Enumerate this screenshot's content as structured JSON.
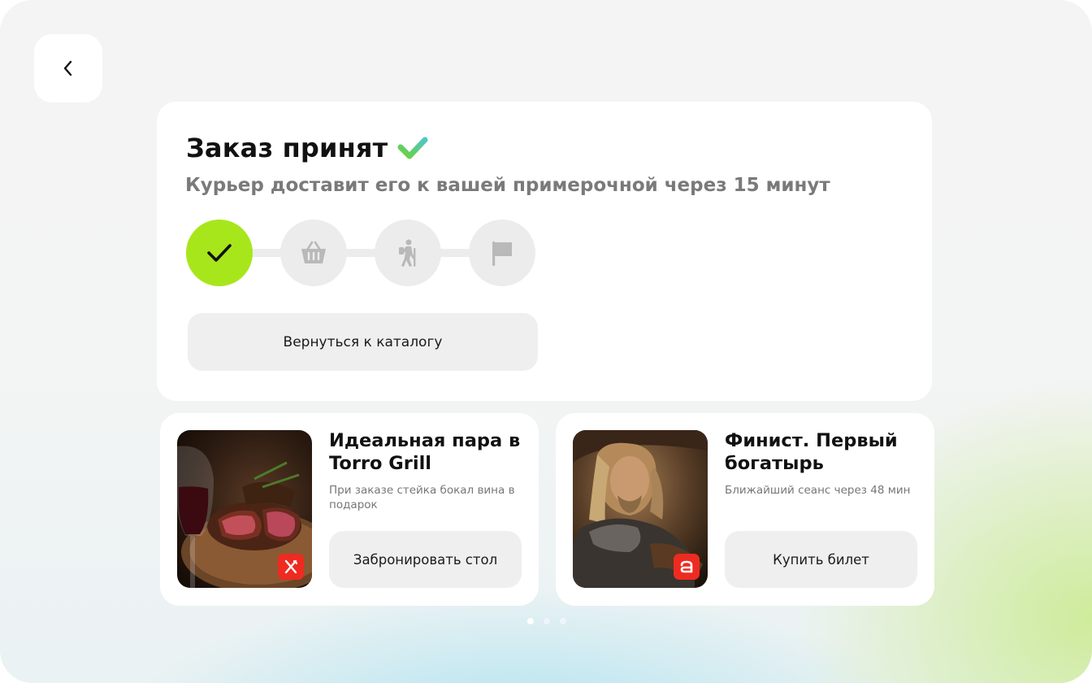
{
  "nav": {
    "back_icon": "chevron-left-icon"
  },
  "order": {
    "title": "Заказ принят",
    "title_icon": "checkmark-icon",
    "subtitle": "Курьер доставит его к вашей примерочной через 15 минут",
    "steps": [
      {
        "icon": "check-icon",
        "state": "done"
      },
      {
        "icon": "basket-icon",
        "state": "pending"
      },
      {
        "icon": "courier-walking-icon",
        "state": "pending"
      },
      {
        "icon": "flag-icon",
        "state": "pending"
      }
    ],
    "catalog_button": "Вернуться к каталогу",
    "accent_color": "#a8e61c"
  },
  "promos": [
    {
      "title": "Идеальная пара в Torro Grill",
      "description": "При заказе стейка бокал вина в подарок",
      "button": "Забронировать стол",
      "badge_icon": "fork-knife-icon"
    },
    {
      "title": "Финист. Первый богатырь",
      "description": "Ближайший сеанс через 48 мин",
      "button": "Купить билет",
      "badge_icon": "cinema-logo-icon"
    }
  ],
  "pagination": {
    "pages": 3,
    "active": 1
  }
}
